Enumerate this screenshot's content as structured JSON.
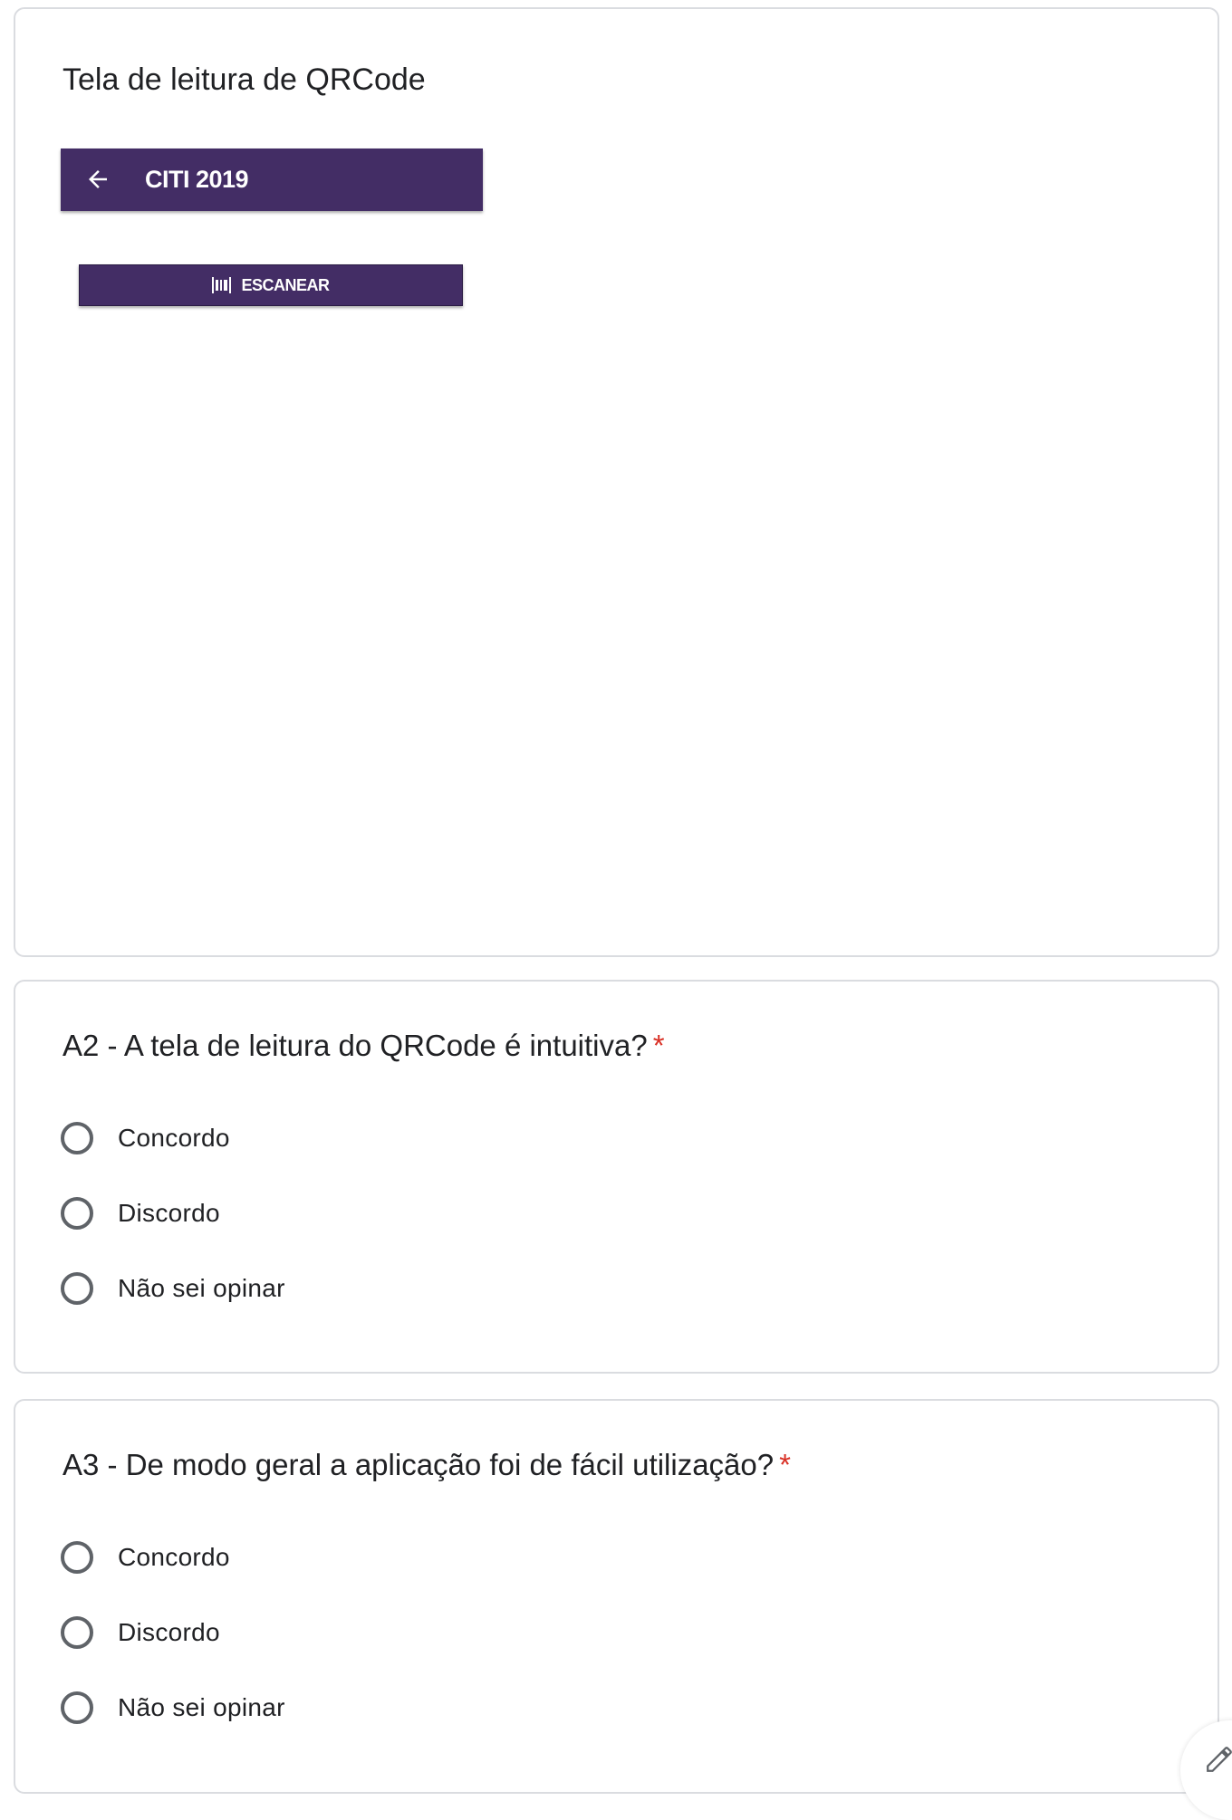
{
  "image_section": {
    "title": "Tela de leitura de QRCode",
    "app_bar": {
      "back_icon": "arrow-back-icon",
      "title": "CITI 2019",
      "color": "#432d65"
    },
    "scan_button": {
      "icon": "barcode-scan-icon",
      "label": "ESCANEAR"
    }
  },
  "questions": [
    {
      "id": "A2",
      "text": "A2 - A tela de leitura do QRCode é intuitiva?",
      "required_mark": "*",
      "options": [
        "Concordo",
        "Discordo",
        "Não sei opinar"
      ]
    },
    {
      "id": "A3",
      "text": "A3 - De modo geral a aplicação foi de fácil utilização?",
      "required_mark": "*",
      "options": [
        "Concordo",
        "Discordo",
        "Não sei opinar"
      ]
    }
  ],
  "colors": {
    "required": "#d93025",
    "border": "#dadce0",
    "radio": "#5f6368"
  },
  "fab": {
    "icon": "edit-pencil-icon"
  }
}
